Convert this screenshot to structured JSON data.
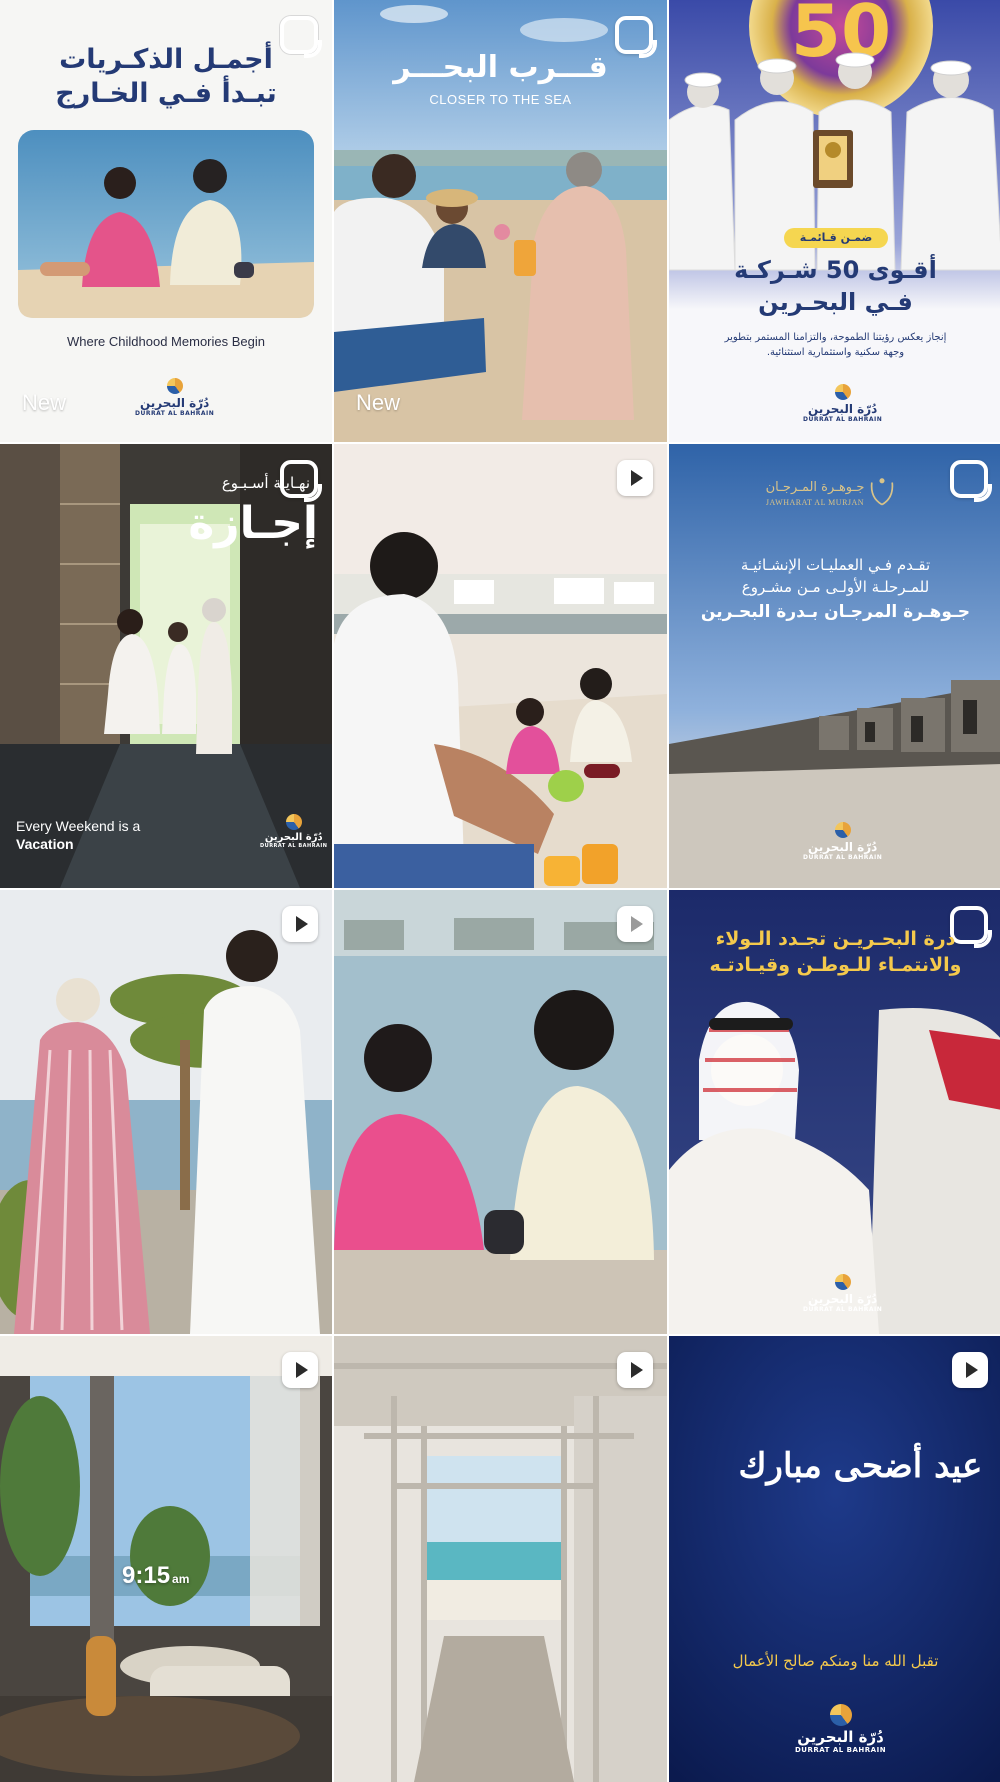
{
  "tiles": [
    {
      "id": "tile-1",
      "badge": "reel-icon",
      "title_line1": "أجمـل الذكـريات",
      "title_line2": "تبـدأ فـي الخـارج",
      "caption": "Where Childhood Memories Begin",
      "tag": "New",
      "logo_ar": "دُرّة البحرين",
      "logo_en": "DURRAT AL BAHRAIN"
    },
    {
      "id": "tile-2",
      "badge": "reel-icon",
      "title_ar": "قـــرب البحـــر",
      "title_en": "CLOSER TO THE SEA",
      "tag": "New"
    },
    {
      "id": "tile-3",
      "badge": "none",
      "number": "50",
      "ribbon": "ضمـن قـائمـة",
      "title_line1": "أقـوى 50 شـركـة",
      "title_line2": "فـي البحـرين",
      "body_line1": "إنجاز يعكس رؤيتنا الطموحة، والتزامنا المستمر بتطوير",
      "body_line2": "وجهة سكنية واستثمارية استثنائية.",
      "logo_ar": "دُرّة البحرين",
      "logo_en": "DURRAT AL BAHRAIN"
    },
    {
      "id": "tile-4",
      "badge": "reel-icon",
      "kicker_ar": "نهـايـة أسـبـوع",
      "title_ar": "إجـازة",
      "caption_line1": "Every Weekend is a",
      "caption_line2": "Vacation",
      "logo_ar": "دُرّة البحرين",
      "logo_en": "DURRAT AL BAHRAIN"
    },
    {
      "id": "tile-5",
      "badge": "play-icon"
    },
    {
      "id": "tile-6",
      "badge": "reel-icon",
      "brand_ar": "جـوهـرة المـرجـان",
      "brand_en": "JAWHARAT AL MURJAN",
      "line1": "تقـدم فـي العمليـات الإنشـائيـة",
      "line2": "للمـرحلـة الأولـى مـن مشـروع",
      "line3": "جـوهـرة المرجـان بـدرة البحـرين",
      "logo_ar": "دُرّة البحرين",
      "logo_en": "DURRAT AL BAHRAIN"
    },
    {
      "id": "tile-7",
      "badge": "play-icon"
    },
    {
      "id": "tile-8",
      "badge": "play-icon"
    },
    {
      "id": "tile-9",
      "badge": "reel-icon",
      "title_line1": "درة البحـريـن تجـدد الـولاء",
      "title_line2": "والانتمـاء للـوطـن وقيـادتـه",
      "logo_ar": "دُرّة البحرين",
      "logo_en": "DURRAT AL BAHRAIN"
    },
    {
      "id": "tile-10",
      "badge": "play-icon",
      "time": "9:15",
      "time_suffix": "am"
    },
    {
      "id": "tile-11",
      "badge": "play-icon"
    },
    {
      "id": "tile-12",
      "badge": "play-icon",
      "greeting": "عيد أضحى مبارك",
      "subtitle": "تقبل الله منا ومنكم صالح الأعمال",
      "logo_ar": "دُرّة البحرين",
      "logo_en": "DURRAT AL BAHRAIN"
    }
  ]
}
